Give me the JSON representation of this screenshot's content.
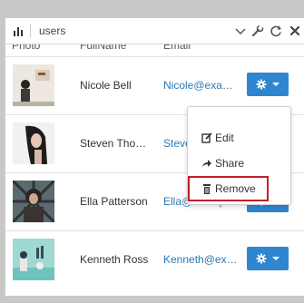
{
  "toolbar": {
    "title": "users",
    "icons": [
      "bar-chart-icon",
      "chevron-down-icon",
      "wrench-icon",
      "refresh-icon",
      "close-icon"
    ]
  },
  "columns": [
    "Photo",
    "FullName",
    "Email"
  ],
  "rows": [
    {
      "name": "Nicole Bell",
      "email": "Nicole@exa…"
    },
    {
      "name": "Steven Tho…",
      "email": "Steve"
    },
    {
      "name": "Ella Patterson",
      "email": "Ella@exampl…"
    },
    {
      "name": "Kenneth Ross",
      "email": "Kenneth@ex…"
    }
  ],
  "menu": {
    "items": [
      {
        "label": "Edit",
        "icon": "edit-icon"
      },
      {
        "label": "Share",
        "icon": "share-icon"
      },
      {
        "label": "Remove",
        "icon": "trash-icon"
      }
    ]
  },
  "colors": {
    "accent": "#2e86d1",
    "link": "#2a7ab8",
    "highlight": "#c0202a"
  }
}
